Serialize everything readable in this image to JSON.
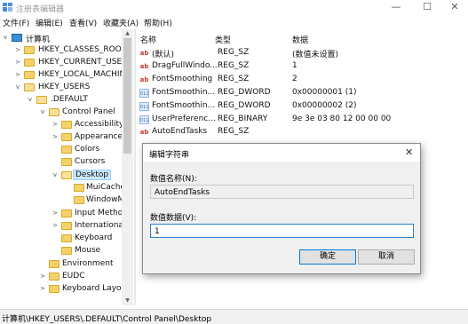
{
  "window": {
    "title": "注册表编辑器",
    "minimize": "—",
    "maximize": "☐",
    "close": "✕"
  },
  "menu": [
    "文件(F)",
    "编辑(E)",
    "查看(V)",
    "收藏夹(A)",
    "帮助(H)"
  ],
  "tree": {
    "root": "计算机",
    "items": [
      {
        "label": "HKEY_CLASSES_ROOT",
        "expander": ">"
      },
      {
        "label": "HKEY_CURRENT_USER",
        "expander": ">"
      },
      {
        "label": "HKEY_LOCAL_MACHINE",
        "expander": ">"
      },
      {
        "label": "HKEY_USERS",
        "expander": "v"
      },
      {
        "label": ".DEFAULT",
        "expander": "v"
      },
      {
        "label": "Control Panel",
        "expander": "v"
      },
      {
        "label": "Accessibility",
        "expander": ">"
      },
      {
        "label": "Appearance",
        "expander": ">"
      },
      {
        "label": "Colors",
        "expander": ""
      },
      {
        "label": "Cursors",
        "expander": ""
      },
      {
        "label": "Desktop",
        "expander": "v"
      },
      {
        "label": "MuiCache",
        "expander": ""
      },
      {
        "label": "WindowM",
        "expander": ""
      },
      {
        "label": "Input Metho",
        "expander": ">"
      },
      {
        "label": "International",
        "expander": ">"
      },
      {
        "label": "Keyboard",
        "expander": ""
      },
      {
        "label": "Mouse",
        "expander": ""
      },
      {
        "label": "Environment",
        "expander": ""
      },
      {
        "label": "EUDC",
        "expander": ">"
      },
      {
        "label": "Keyboard Layou",
        "expander": ">"
      }
    ]
  },
  "list": {
    "headers": {
      "name": "名称",
      "type": "类型",
      "data": "数据"
    },
    "rows": [
      {
        "icon": "ab",
        "name": "(默认)",
        "type": "REG_SZ",
        "data": "(数值未设置)"
      },
      {
        "icon": "ab",
        "name": "DragFullWindo...",
        "type": "REG_SZ",
        "data": "1"
      },
      {
        "icon": "ab",
        "name": "FontSmoothing",
        "type": "REG_SZ",
        "data": "2"
      },
      {
        "icon": "011",
        "name": "FontSmoothin...",
        "type": "REG_DWORD",
        "data": "0x00000001 (1)"
      },
      {
        "icon": "011",
        "name": "FontSmoothin...",
        "type": "REG_DWORD",
        "data": "0x00000002 (2)"
      },
      {
        "icon": "011",
        "name": "UserPreferenc...",
        "type": "REG_BINARY",
        "data": "9e 3e 03 80 12 00 00 00"
      },
      {
        "icon": "ab",
        "name": "AutoEndTasks",
        "type": "REG_SZ",
        "data": ""
      }
    ]
  },
  "dialog": {
    "title": "编辑字符串",
    "close": "✕",
    "name_label": "数值名称(N):",
    "name_value": "AutoEndTasks",
    "data_label": "数值数据(V):",
    "data_value": "1",
    "ok_label": "确定",
    "cancel_label": "取消"
  },
  "status": {
    "path": "计算机\\HKEY_USERS\\.DEFAULT\\Control Panel\\Desktop"
  }
}
